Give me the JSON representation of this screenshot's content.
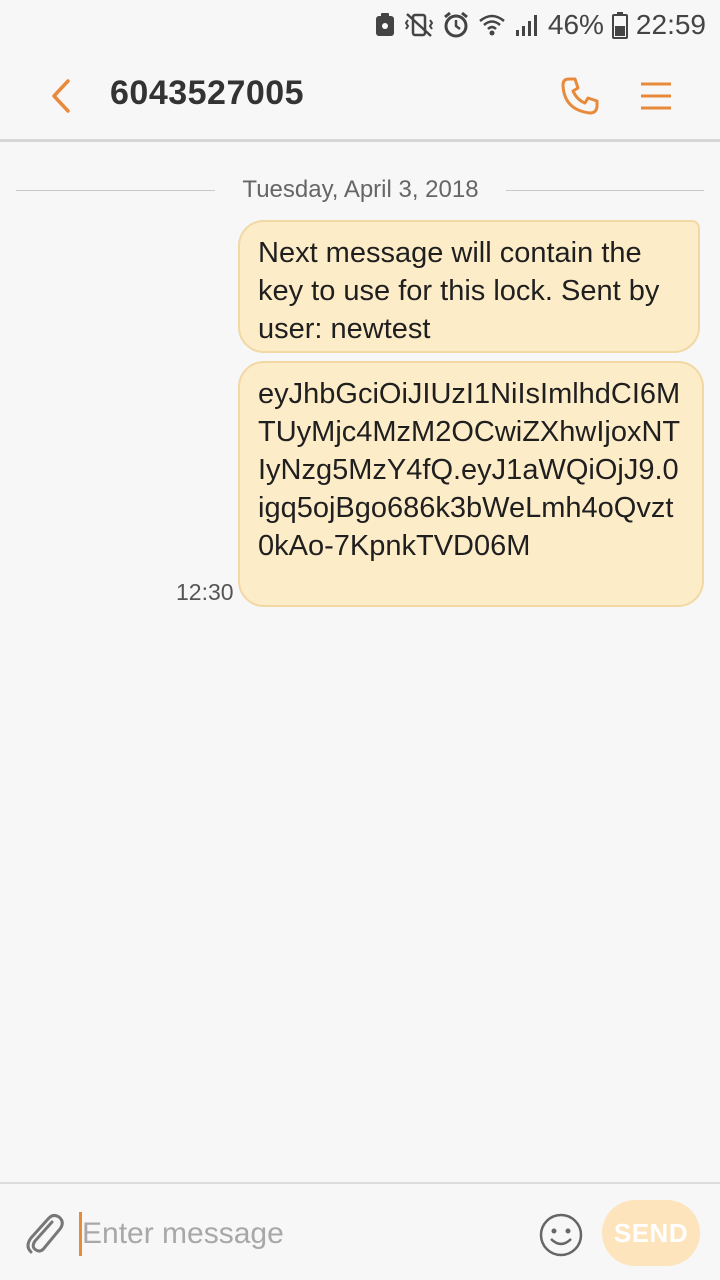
{
  "status_bar": {
    "battery_percent": "46%",
    "time": "22:59",
    "icons": [
      "notification-icon",
      "vibrate-icon",
      "alarm-icon",
      "wifi-icon",
      "signal-icon",
      "battery-icon"
    ]
  },
  "header": {
    "contact": "6043527005",
    "icons": [
      "back-arrow-icon",
      "phone-icon",
      "menu-icon"
    ],
    "accent_color": "#e88a3b"
  },
  "conversation": {
    "date": "Tuesday, April 3, 2018",
    "messages": [
      {
        "text": "Next message will contain the key to use for this lock. Sent by user: newtest"
      },
      {
        "text": "eyJhbGciOiJIUzI1NiIsImlhdCI6MTUyMjc4MzM2OCwiZXhwIjoxNTIyNzg5MzY4fQ.eyJ1aWQiOjJ9.0igq5ojBgo686k3bWeLmh4oQvzt0kAo-7KpnkTVD06M",
        "time": "12:30"
      }
    ],
    "bubble_color": "#fdecc8"
  },
  "composer": {
    "placeholder": "Enter message",
    "send_label": "SEND",
    "icons": [
      "paperclip-icon",
      "emoji-icon"
    ]
  }
}
